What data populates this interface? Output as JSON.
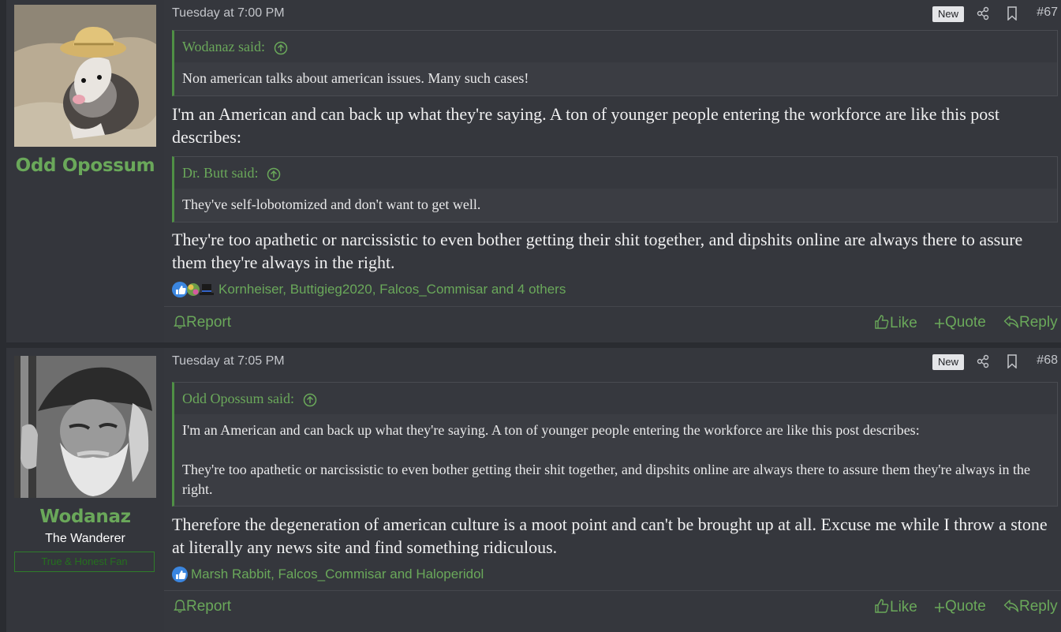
{
  "posts": [
    {
      "username": "Odd Opossum",
      "time": "Tuesday at 7:00 PM",
      "badge": "New",
      "number": "#67",
      "quotes": [
        {
          "author": "Wodanaz said:",
          "text": "Non american talks about american issues. Many such cases!"
        },
        {
          "author": "Dr. Butt said:",
          "text": "They've self-lobotomized and don't want to get well."
        }
      ],
      "paragraphs": [
        "I'm an American and can back up what they're saying. A ton of younger people entering the workforce are like this post describes:",
        "They're too apathetic or narcissistic to even bother getting their shit together, and dipshits online are always there to assure them they're always in the right."
      ],
      "reactions": "Kornheiser, Buttigieg2020, Falcos_Commisar and 4 others",
      "report": "Report",
      "like": "Like",
      "quote": "Quote",
      "reply": "Reply"
    },
    {
      "username": "Wodanaz",
      "user_title": "The Wanderer",
      "user_banner": "True & Honest Fan",
      "time": "Tuesday at 7:05 PM",
      "badge": "New",
      "number": "#68",
      "quotes": [
        {
          "author": "Odd Opossum said:",
          "text1": "I'm an American and can back up what they're saying. A ton of younger people entering the workforce are like this post describes:",
          "text2": "They're too apathetic or narcissistic to even bother getting their shit together, and dipshits online are always there to assure them they're always in the right."
        }
      ],
      "paragraphs": [
        "Therefore the degeneration of american culture is a moot point and can't be brought up at all. Excuse me while I throw a stone at literally any news site and find something ridiculous."
      ],
      "reactions": "Marsh Rabbit, Falcos_Commisar and Haloperidol",
      "report": "Report",
      "like": "Like",
      "quote": "Quote",
      "reply": "Reply"
    }
  ],
  "icons": {
    "share": "share-icon",
    "bookmark": "bookmark-icon",
    "quote_up": "arrow-up-circle-icon",
    "report": "bell-icon",
    "like": "thumbs-up-icon",
    "quote": "plus-icon",
    "reply": "reply-icon"
  },
  "colors": {
    "accent_green": "#6aa85a",
    "background": "#35373d",
    "text": "#f0f0f1"
  }
}
